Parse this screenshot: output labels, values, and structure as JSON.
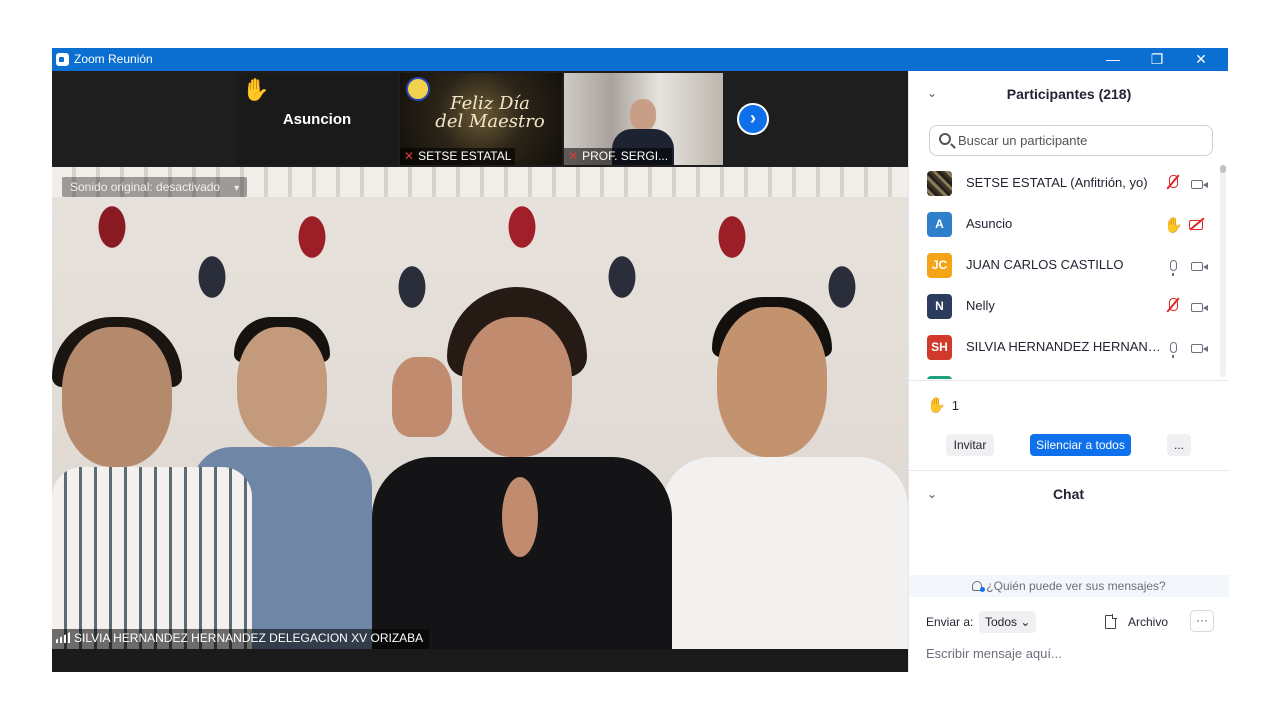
{
  "window": {
    "title": "Zoom Reunión",
    "controls": {
      "minimize": "—",
      "restore": "❐",
      "close": "✕"
    }
  },
  "gallery_strip": {
    "tiles": [
      {
        "name": "Asuncion",
        "hand_raised": true
      },
      {
        "label": "SETSE ESTATAL",
        "muted": true,
        "slide_text_line1": "Feliz Día",
        "slide_text_line2": "del Maestro"
      },
      {
        "label": "PROF. SERGI...",
        "muted": true
      }
    ],
    "next_icon": "chevron-right-icon",
    "next_glyph": "›"
  },
  "main_video": {
    "sound_option": "Sonido original: desactivado",
    "sound_caret": "▾",
    "speaker_label": "SILVIA HERNANDEZ HERNANDEZ DELEGACION XV ORIZABA"
  },
  "participants_panel": {
    "collapse_glyph": "⌄",
    "title": "Participantes (218)",
    "search_placeholder": "Buscar un participante",
    "participants": [
      {
        "name": "SETSE ESTATAL (Anfitrión, yo)",
        "avatar_type": "image",
        "mic": "muted",
        "video": "on"
      },
      {
        "name": "Asuncio",
        "initials": "A",
        "avatar_color": "#2d80c9",
        "hand": true,
        "video": "off"
      },
      {
        "name": "JUAN CARLOS CASTILLO",
        "initials": "JC",
        "avatar_color": "#f4a417",
        "mic": "on",
        "video": "on"
      },
      {
        "name": "Nelly",
        "initials": "N",
        "avatar_color": "#2b3c5c",
        "mic": "muted",
        "video": "on"
      },
      {
        "name": "SILVIA HERNANDEZ HERNANDE...",
        "initials": "SH",
        "avatar_color": "#d1392b",
        "mic": "on",
        "video": "on"
      },
      {
        "name": "",
        "initials": "",
        "avatar_color": "#1aa37a"
      }
    ],
    "raised_hands_count": "1",
    "invite_label": "Invitar",
    "mute_all_label": "Silenciar a todos",
    "more_label": "..."
  },
  "chat_panel": {
    "collapse_glyph": "⌄",
    "title": "Chat",
    "who_can_see": "¿Quién puede ver sus mensajes?",
    "send_to_label": "Enviar a:",
    "recipient": "Todos",
    "recipient_caret": "⌄",
    "file_label": "Archivo",
    "more_label": "···",
    "message_placeholder": "Escribir mensaje aquí..."
  },
  "colors": {
    "titlebar": "#0b6fd1",
    "accent_blue": "#0e71eb",
    "muted_red": "#e02828",
    "hand_yellow": "#f5b400"
  }
}
